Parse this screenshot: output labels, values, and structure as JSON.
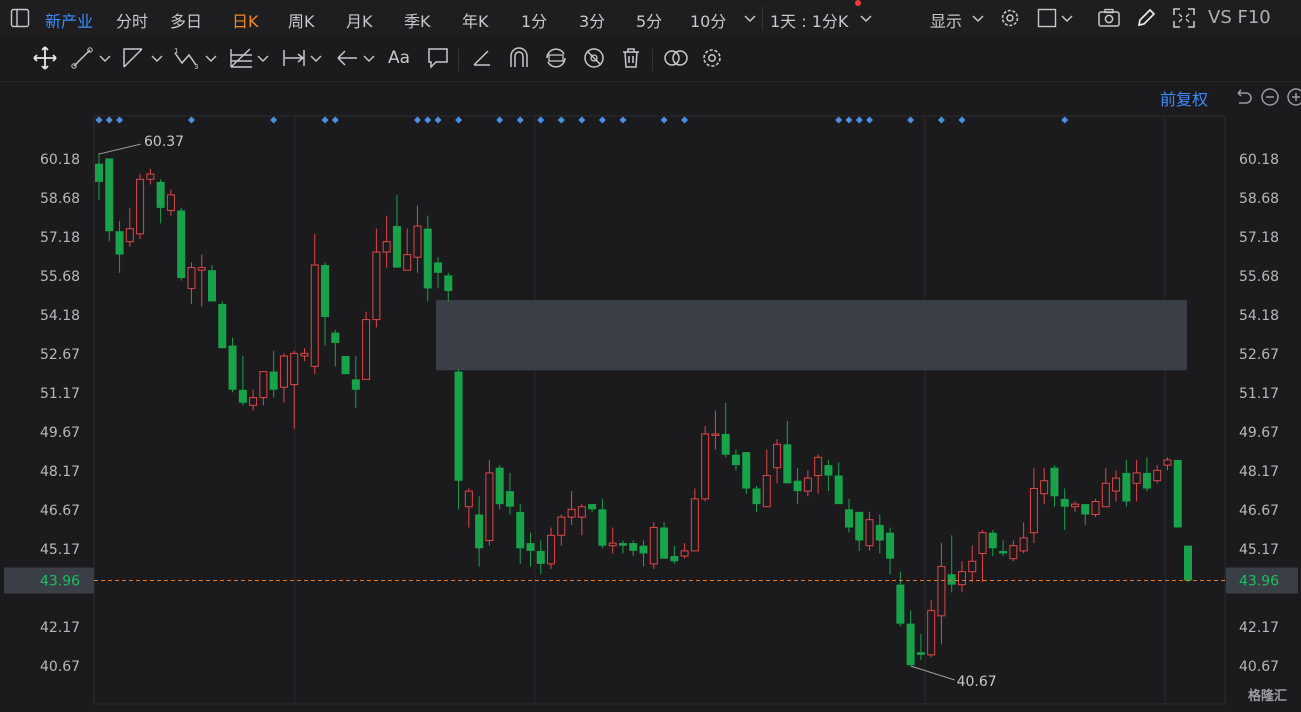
{
  "topbar": {
    "sector": "新产业",
    "periods": [
      "分时",
      "多日",
      "日K",
      "周K",
      "月K",
      "季K",
      "年K",
      "1分",
      "3分",
      "5分",
      "10分"
    ],
    "selected_period": "日K",
    "range": "1天 : 1分K",
    "display": "显示",
    "f10": "VS F10"
  },
  "toolbar": {
    "text_tool": "Aa"
  },
  "chart": {
    "adjust_label": "前复权",
    "price_labels": [
      "60.18",
      "58.68",
      "57.18",
      "55.68",
      "54.18",
      "52.67",
      "51.17",
      "49.67",
      "48.17",
      "46.67",
      "45.17",
      "42.17",
      "40.67"
    ],
    "current_price": "43.96",
    "high_marker": "60.37",
    "low_marker": "40.67",
    "watermark": "格隆汇",
    "up_color": "#e04646",
    "down_color": "#18a34a"
  },
  "chart_data": {
    "type": "candlestick",
    "ylim": [
      39.9,
      61.8
    ],
    "high": 60.37,
    "low": 40.67,
    "last": 43.96,
    "candles": [
      [
        60.0,
        59.3,
        60.4,
        58.6
      ],
      [
        60.2,
        57.4,
        60.2,
        57.0
      ],
      [
        57.4,
        56.5,
        57.8,
        55.8
      ],
      [
        57.0,
        57.5,
        58.3,
        56.8
      ],
      [
        57.3,
        59.4,
        59.6,
        57.1
      ],
      [
        59.4,
        59.6,
        59.8,
        59.2
      ],
      [
        59.3,
        58.3,
        59.4,
        57.7
      ],
      [
        58.2,
        58.8,
        59.0,
        58.0
      ],
      [
        58.2,
        55.6,
        58.3,
        55.5
      ],
      [
        55.2,
        56.0,
        56.2,
        54.6
      ],
      [
        55.9,
        56.0,
        56.5,
        54.5
      ],
      [
        55.9,
        54.7,
        56.1,
        54.7
      ],
      [
        54.6,
        52.9,
        54.7,
        52.9
      ],
      [
        53.0,
        51.3,
        53.3,
        51.2
      ],
      [
        51.3,
        50.8,
        52.6,
        50.7
      ],
      [
        50.7,
        51.0,
        51.3,
        50.5
      ],
      [
        51.0,
        52.0,
        52.0,
        50.7
      ],
      [
        52.0,
        51.3,
        52.8,
        51.0
      ],
      [
        51.4,
        52.6,
        52.7,
        50.8
      ],
      [
        51.5,
        52.7,
        52.8,
        49.8
      ],
      [
        52.6,
        52.7,
        52.9,
        52.4
      ],
      [
        52.2,
        56.1,
        57.3,
        51.9
      ],
      [
        56.1,
        54.1,
        56.2,
        53.0
      ],
      [
        53.5,
        53.1,
        53.6,
        52.2
      ],
      [
        52.6,
        51.9,
        52.6,
        51.9
      ],
      [
        51.7,
        51.3,
        52.6,
        50.6
      ],
      [
        51.7,
        54.0,
        54.3,
        51.7
      ],
      [
        54.0,
        56.6,
        57.5,
        53.7
      ],
      [
        56.6,
        57.0,
        58.0,
        56.0
      ],
      [
        57.6,
        56.0,
        58.8,
        56.0
      ],
      [
        55.9,
        56.5,
        57.5,
        55.9
      ],
      [
        56.4,
        57.6,
        58.4,
        55.8
      ],
      [
        57.5,
        55.2,
        58.0,
        54.7
      ],
      [
        56.2,
        55.8,
        56.4,
        55.2
      ],
      [
        55.7,
        55.1,
        55.8,
        54.7
      ],
      [
        52.0,
        47.8,
        52.1,
        46.7
      ],
      [
        46.8,
        47.4,
        47.5,
        46.0
      ],
      [
        46.5,
        45.2,
        47.2,
        44.5
      ],
      [
        45.5,
        48.1,
        48.6,
        45.3
      ],
      [
        48.3,
        46.9,
        48.4,
        46.7
      ],
      [
        47.4,
        46.8,
        48.1,
        46.5
      ],
      [
        46.6,
        45.2,
        46.9,
        44.6
      ],
      [
        45.4,
        45.1,
        45.8,
        44.5
      ],
      [
        45.1,
        44.6,
        45.5,
        44.2
      ],
      [
        44.6,
        45.7,
        46.0,
        44.4
      ],
      [
        45.7,
        46.4,
        46.5,
        45.3
      ],
      [
        46.4,
        46.7,
        47.4,
        46.1
      ],
      [
        46.4,
        46.8,
        46.9,
        45.7
      ],
      [
        46.9,
        46.7,
        46.9,
        46.6
      ],
      [
        46.7,
        45.3,
        47.1,
        45.2
      ],
      [
        45.3,
        45.4,
        46.0,
        45.0
      ],
      [
        45.4,
        45.3,
        45.5,
        45.0
      ],
      [
        45.4,
        45.1,
        45.5,
        44.9
      ],
      [
        45.3,
        45.0,
        45.5,
        44.5
      ],
      [
        44.6,
        46.0,
        46.2,
        44.4
      ],
      [
        46.0,
        44.8,
        46.2,
        44.8
      ],
      [
        44.9,
        44.7,
        45.3,
        44.6
      ],
      [
        44.9,
        45.1,
        45.4,
        44.8
      ],
      [
        45.1,
        47.1,
        47.5,
        45.1
      ],
      [
        47.1,
        49.6,
        49.9,
        47.0
      ],
      [
        49.6,
        49.6,
        50.5,
        49.0
      ],
      [
        49.6,
        48.8,
        50.8,
        48.7
      ],
      [
        48.8,
        48.4,
        49.0,
        48.2
      ],
      [
        48.9,
        47.5,
        48.9,
        47.3
      ],
      [
        47.5,
        46.9,
        47.6,
        46.6
      ],
      [
        46.8,
        48.0,
        49.0,
        46.8
      ],
      [
        48.3,
        49.2,
        49.4,
        47.7
      ],
      [
        49.2,
        47.7,
        50.1,
        47.7
      ],
      [
        47.8,
        47.4,
        48.3,
        46.9
      ],
      [
        47.4,
        47.9,
        48.2,
        47.2
      ],
      [
        48.0,
        48.7,
        48.8,
        47.3
      ],
      [
        48.4,
        48.0,
        48.6,
        47.4
      ],
      [
        48.0,
        46.9,
        48.5,
        46.9
      ],
      [
        46.7,
        46.0,
        47.1,
        45.8
      ],
      [
        46.6,
        45.5,
        46.6,
        45.1
      ],
      [
        45.3,
        46.3,
        46.6,
        45.1
      ],
      [
        46.1,
        45.5,
        46.5,
        45.0
      ],
      [
        45.8,
        44.8,
        46.0,
        44.2
      ],
      [
        43.8,
        42.3,
        44.3,
        42.2
      ],
      [
        42.3,
        40.7,
        42.8,
        40.7
      ],
      [
        41.2,
        41.1,
        41.9,
        40.9
      ],
      [
        41.1,
        42.8,
        43.2,
        41.0
      ],
      [
        42.6,
        44.5,
        45.4,
        41.5
      ],
      [
        44.2,
        43.8,
        45.7,
        43.5
      ],
      [
        43.8,
        44.3,
        44.7,
        43.5
      ],
      [
        44.3,
        44.7,
        45.3,
        43.9
      ],
      [
        45.0,
        45.8,
        45.9,
        43.9
      ],
      [
        45.8,
        45.2,
        45.9,
        44.9
      ],
      [
        45.1,
        45.0,
        45.5,
        44.9
      ],
      [
        44.8,
        45.3,
        45.5,
        44.7
      ],
      [
        45.1,
        45.6,
        46.2,
        45.0
      ],
      [
        45.8,
        47.5,
        48.3,
        45.4
      ],
      [
        47.3,
        47.8,
        48.3,
        46.9
      ],
      [
        48.3,
        47.2,
        48.4,
        46.8
      ],
      [
        47.1,
        46.8,
        47.5,
        45.9
      ],
      [
        46.8,
        46.9,
        47.0,
        46.6
      ],
      [
        46.9,
        46.5,
        46.9,
        46.1
      ],
      [
        46.5,
        47.0,
        47.1,
        46.4
      ],
      [
        46.8,
        47.7,
        48.3,
        46.8
      ],
      [
        47.4,
        47.9,
        48.2,
        47.0
      ],
      [
        48.1,
        47.0,
        48.6,
        46.8
      ],
      [
        47.7,
        48.1,
        48.6,
        47.0
      ],
      [
        48.1,
        47.5,
        48.7,
        47.4
      ],
      [
        47.8,
        48.2,
        48.4,
        47.7
      ],
      [
        48.4,
        48.6,
        48.7,
        48.2
      ],
      [
        48.6,
        46.0,
        48.6,
        46.0
      ],
      [
        45.3,
        43.96,
        45.3,
        43.9
      ]
    ],
    "markers": [
      0,
      1,
      2,
      9,
      17,
      22,
      23,
      31,
      32,
      33,
      35,
      39,
      41,
      43,
      45,
      47,
      49,
      51,
      55,
      57,
      72,
      73,
      74,
      75,
      79,
      82,
      84,
      94
    ]
  }
}
